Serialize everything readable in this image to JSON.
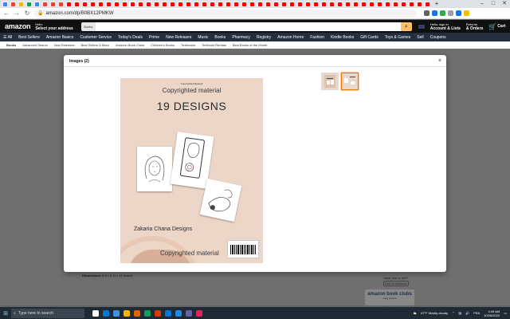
{
  "browser": {
    "tab_colors": [
      "#4285f4",
      "#ea4335",
      "#f4b400",
      "#0f9d58",
      "#4285f4",
      "#ea4335",
      "#ea4335",
      "#ea4335",
      "#ff0000",
      "#ff0000",
      "#ff0000",
      "#ff0000",
      "#ff0000",
      "#ff0000",
      "#ff0000",
      "#ff0000",
      "#ff0000",
      "#ff0000",
      "#ff0000",
      "#ff0000",
      "#ff0000",
      "#ff0000",
      "#ff0000",
      "#ff0000",
      "#ff0000",
      "#ff0000",
      "#ff0000",
      "#ff0000",
      "#ff0000",
      "#ff0000",
      "#ff0000",
      "#ff0000",
      "#ff0000",
      "#ff0000",
      "#ff0000",
      "#ff0000",
      "#ff0000",
      "#ff0000",
      "#ff0000",
      "#ff0000",
      "#ff0000",
      "#ff0000",
      "#ff0000",
      "#ff0000",
      "#ff0000",
      "#ff0000",
      "#ff0000",
      "#ff0000",
      "#ff0000",
      "#ff0000",
      "#ff0000",
      "#ff0000",
      "#ff0000",
      "#ff0000"
    ],
    "url": "amazon.com/dp/B0BX12PMKW"
  },
  "amazon": {
    "logo": "amazon",
    "deliver_line1": "Hello",
    "deliver_line2": "Select your address",
    "search_category": "Books",
    "account_line1": "Hello, sign in",
    "account_line2": "Account & Lists",
    "returns_line1": "Returns",
    "returns_line2": "& Orders",
    "cart_label": "Cart",
    "promo_timer": [
      "45",
      "10",
      "53"
    ],
    "nav": [
      "All",
      "Best Sellers",
      "Amazon Basics",
      "Customer Service",
      "Today's Deals",
      "Prime",
      "New Releases",
      "Music",
      "Books",
      "Pharmacy",
      "Registry",
      "Amazon Home",
      "Fashion",
      "Kindle Books",
      "Gift Cards",
      "Toys & Games",
      "Sell",
      "Coupons"
    ],
    "subnav": [
      "Books",
      "Advanced Search",
      "New Releases",
      "Best Sellers & More",
      "Amazon Book Clubs",
      "Children's Books",
      "Textbooks",
      "Textbook Rentals",
      "Best Books of the Month"
    ]
  },
  "page": {
    "dimensions_label": "Dimensions",
    "dimensions_value": "8.5 x 0.11 x 11 inches",
    "have_one": "Have one to sell?",
    "sell_button": "Sell on Amazon",
    "bookclubs_title": "amazon book clubs",
    "bookclubs_sub": "early access",
    "bookclubs_more": "Join or create a book club"
  },
  "modal": {
    "title": "Images (2)",
    "close": "×",
    "cover": {
      "small_top": "Copyrighted Material",
      "copyright_top": "Copyrighted material",
      "designs": "19 DESIGNS",
      "author": "Zakaria Chana Designs",
      "copyright_bottom": "Copyrighted material"
    },
    "thumbnail_count": 2,
    "selected_thumbnail": 2
  },
  "taskbar": {
    "search_placeholder": "Type here to search",
    "weather": "67°F Mostly cloudy",
    "lang": "FRA",
    "time": "4:49 AM",
    "date": "10/26/2022",
    "app_colors": [
      "#ffffff",
      "#0078d4",
      "#3a96dd",
      "#f4b400",
      "#e66100",
      "#0f9d58",
      "#d83b01",
      "#0078d4",
      "#1e88e5",
      "#6264a7",
      "#e91e63"
    ]
  }
}
